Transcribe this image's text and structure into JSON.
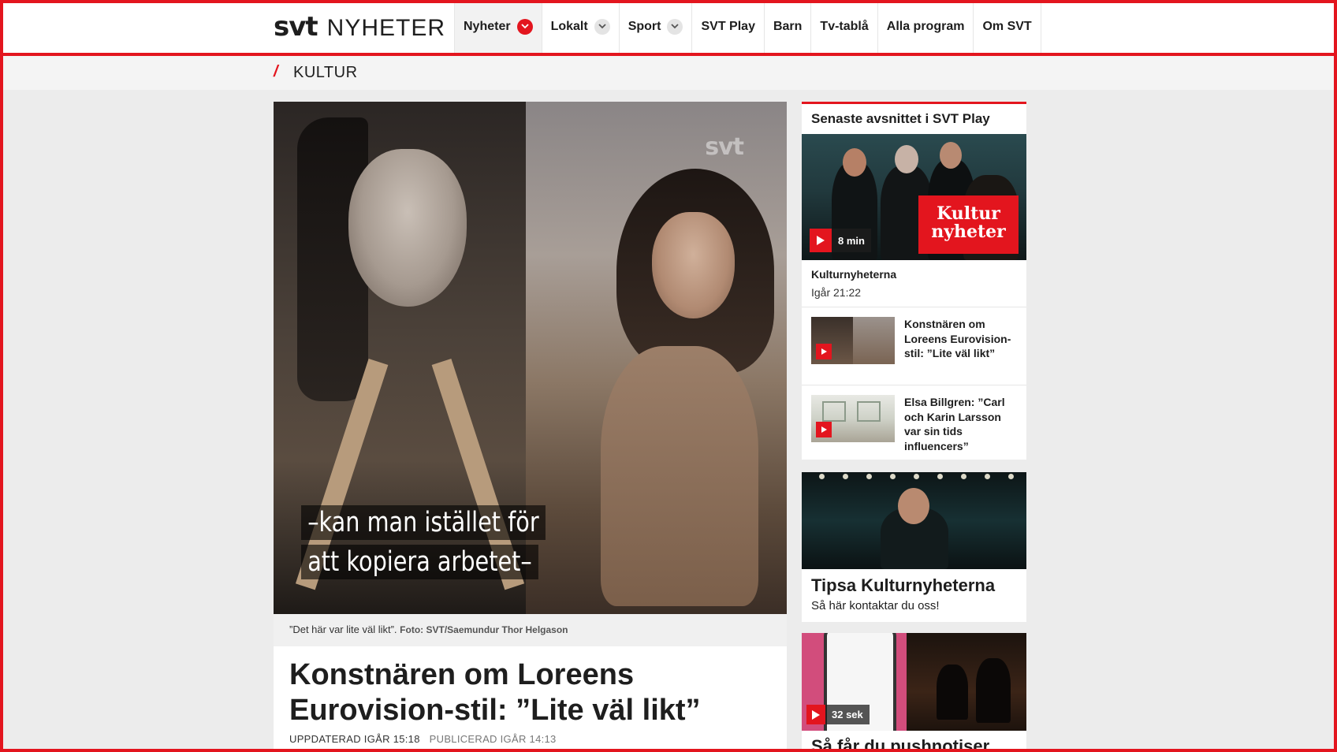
{
  "header": {
    "logo_svt": "svt",
    "logo_nyheter": "NYHETER",
    "nav": [
      {
        "label": "Nyheter",
        "dropdown": true,
        "active": true
      },
      {
        "label": "Lokalt",
        "dropdown": true
      },
      {
        "label": "Sport",
        "dropdown": true
      },
      {
        "label": "SVT Play"
      },
      {
        "label": "Barn"
      },
      {
        "label": "Tv-tablå"
      },
      {
        "label": "Alla program"
      },
      {
        "label": "Om SVT"
      }
    ]
  },
  "breadcrumb": {
    "slash": "/",
    "label": "KULTUR"
  },
  "hero": {
    "watermark": "svt",
    "subtitle_line1": "–kan man istället för",
    "subtitle_line2": "att kopiera arbetet–"
  },
  "caption": {
    "text": "”Det här var lite väl likt”.",
    "credit": "Foto: SVT/Saemundur Thor Helgason"
  },
  "article": {
    "headline": "Konstnären om Loreens Eurovision-stil: ”Lite väl likt”",
    "updated": "UPPDATERAD IGÅR 15:18",
    "published": "PUBLICERAD IGÅR 14:13"
  },
  "sidebar": {
    "play_card": {
      "title": "Senaste avsnittet i SVT Play",
      "badge": "Kultur nyheter",
      "duration": "8 min",
      "program": "Kulturnyheterna",
      "time": "Igår 21:22",
      "items": [
        {
          "title": "Konstnären om Loreens Eurovision-stil: ”Lite väl likt”"
        },
        {
          "title": "Elsa Billgren: ”Carl och Karin Larsson var sin tids influencers”"
        }
      ]
    },
    "tip_card": {
      "title": "Tipsa Kulturnyheterna",
      "subtitle": "Så här kontaktar du oss!"
    },
    "push_card": {
      "duration": "32 sek",
      "title": "Så får du pushnotiser"
    }
  },
  "colors": {
    "accent": "#e3151e",
    "background": "#ececec"
  }
}
